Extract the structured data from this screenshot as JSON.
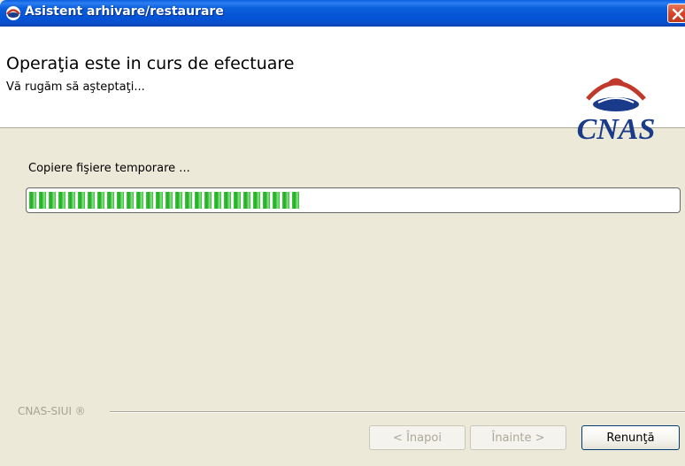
{
  "window": {
    "title": "Asistent arhivare/restaurare",
    "icon": "cnas-app-icon",
    "close_icon": "close-icon"
  },
  "header": {
    "title": "Operaţia este in curs de efectuare",
    "subtitle": "Vă rugăm să aşteptaţi...",
    "logo_text": "CNAS"
  },
  "progress": {
    "status": "Copiere fişiere temporare ...",
    "value": 0.41,
    "color": "#2bb82b"
  },
  "footer": {
    "brand": "CNAS-SIUI ®",
    "buttons": {
      "back": "< Înapoi",
      "next": "Înainte >",
      "cancel": "Renunţă"
    }
  },
  "colors": {
    "titlebar": "#0453d6",
    "logo_blue": "#1a3a8a",
    "logo_red": "#c0392b"
  }
}
